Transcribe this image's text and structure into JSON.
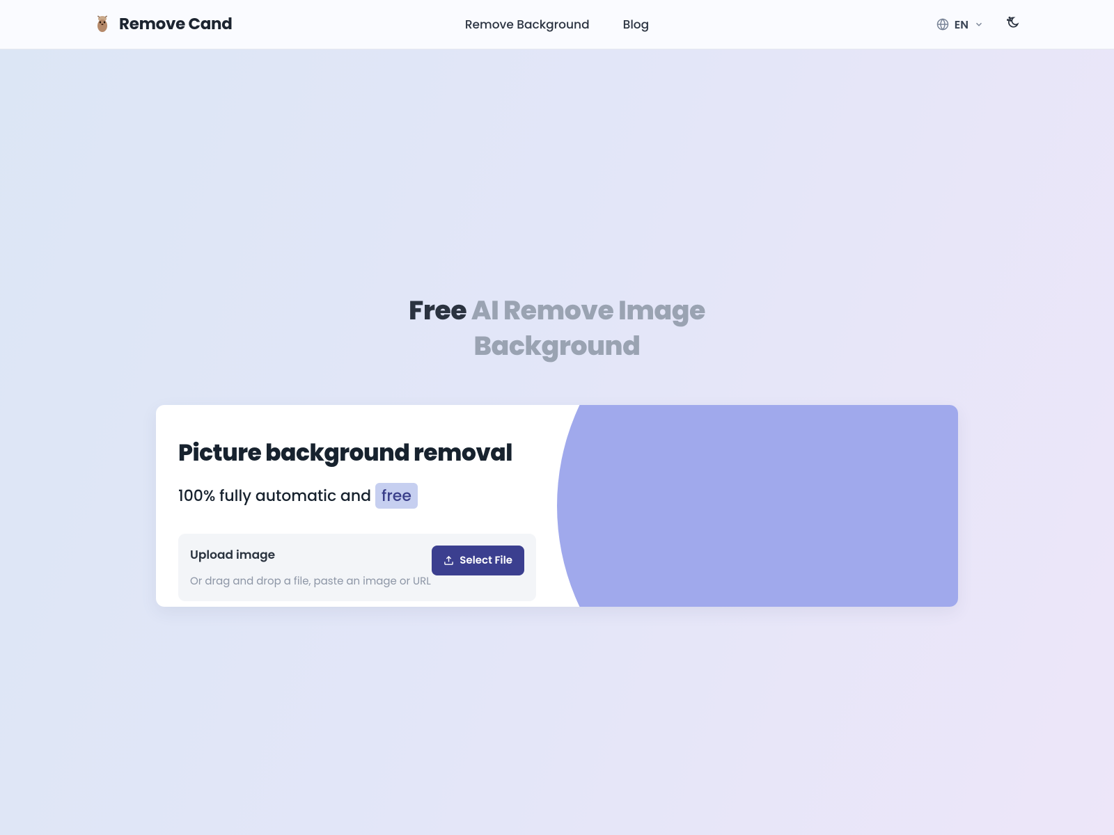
{
  "header": {
    "brand": "Remove Cand",
    "nav": {
      "remove_bg": "Remove Background",
      "blog": "Blog"
    },
    "lang": "EN"
  },
  "hero": {
    "title_dark_1": "Free",
    "title_light_1": "AI Remove Image",
    "title_light_2": "Background"
  },
  "card": {
    "heading": "Picture background removal",
    "subtitle_prefix": "100% fully automatic and",
    "subtitle_badge": "free",
    "upload_label": "Upload image",
    "upload_hint": "Or drag and drop a file, paste an image or URL",
    "select_button": "Select File"
  },
  "colors": {
    "accent": "#3b3f8f",
    "circle": "#a0a9ec",
    "badge_bg": "#c6cff0"
  }
}
